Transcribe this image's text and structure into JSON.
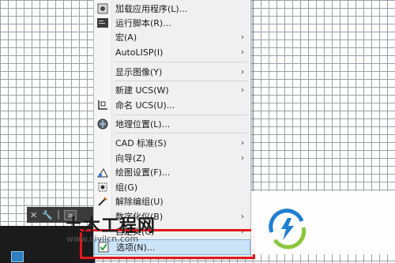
{
  "commandline": {
    "prompt_label": "≥"
  },
  "menu": {
    "items": [
      {
        "label": "…",
        "icon": "toolbar-icon",
        "submenu": false
      },
      {
        "label": "加载应用程序(L)...",
        "icon": "load-app-icon",
        "submenu": false
      },
      {
        "label": "运行脚本(R)...",
        "icon": "script-icon",
        "submenu": false
      },
      {
        "label": "宏(A)",
        "icon": "",
        "submenu": true
      },
      {
        "label": "AutoLISP(I)",
        "icon": "",
        "submenu": true
      },
      {
        "label": "显示图像(Y)",
        "icon": "",
        "submenu": true
      },
      {
        "label": "新建 UCS(W)",
        "icon": "",
        "submenu": true
      },
      {
        "label": "命名 UCS(U)...",
        "icon": "ucs-icon",
        "submenu": false
      },
      {
        "label": "地理位置(L)...",
        "icon": "globe-icon",
        "submenu": false
      },
      {
        "label": "CAD 标准(S)",
        "icon": "",
        "submenu": true
      },
      {
        "label": "向导(Z)",
        "icon": "",
        "submenu": true
      },
      {
        "label": "绘图设置(F)...",
        "icon": "drafting-settings-icon",
        "submenu": false
      },
      {
        "label": "组(G)",
        "icon": "group-icon",
        "submenu": false
      },
      {
        "label": "解除编组(U)",
        "icon": "ungroup-icon",
        "submenu": false
      },
      {
        "label": "数字化仪(B)",
        "icon": "",
        "submenu": true
      },
      {
        "label": "自定义(C)",
        "icon": "",
        "submenu": true
      },
      {
        "label": "选项(N)...",
        "icon": "options-check-icon",
        "submenu": false
      }
    ]
  },
  "watermark": {
    "title": "土木工程网",
    "url": "www.civilcn.com"
  },
  "colors": {
    "highlight": "#cce4f7",
    "red_box": "#e0171b",
    "logo_blue": "#1f7fd1",
    "logo_green": "#8cc63f"
  }
}
